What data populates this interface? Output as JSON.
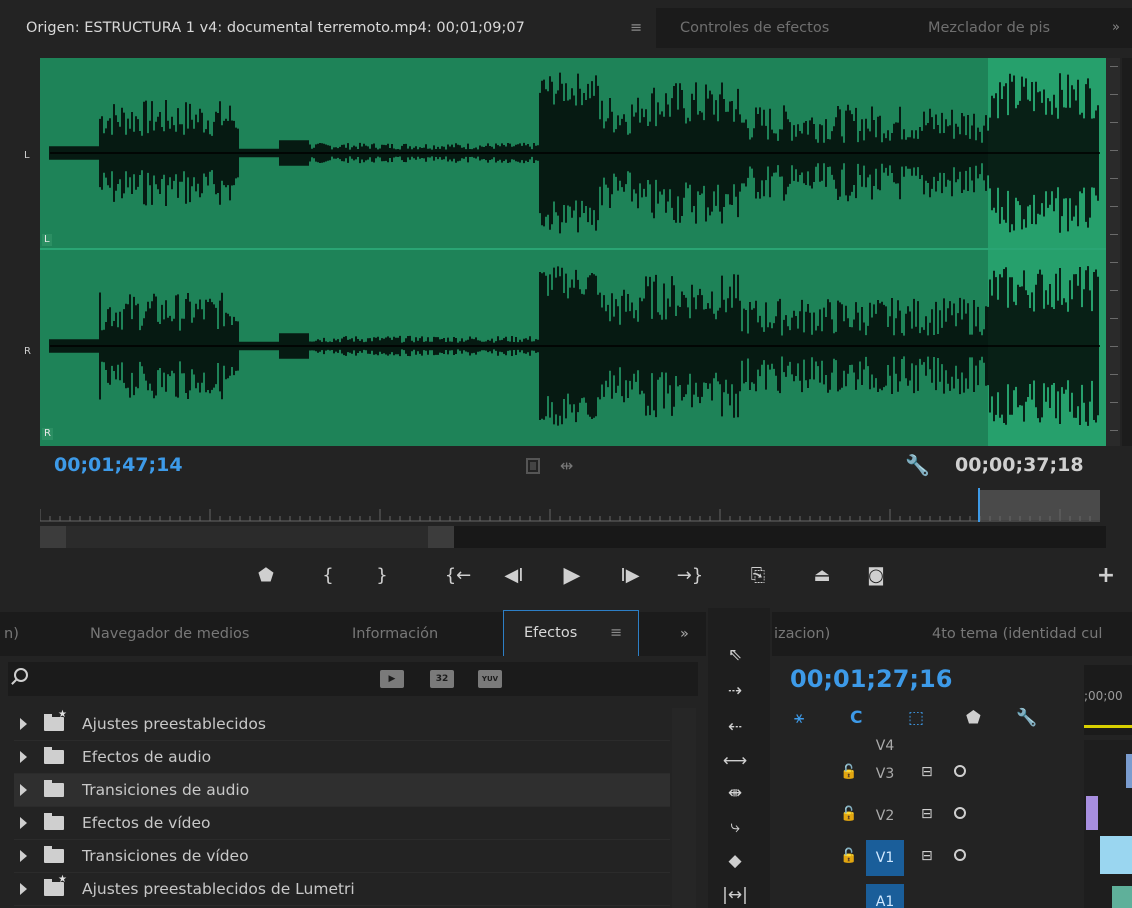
{
  "source_monitor": {
    "title": "Origen: ESTRUCTURA 1 v4: documental terremoto.mp4: 00;01;09;07",
    "menu_glyph": "≡",
    "tabs": [
      "Controles de efectos",
      "Mezclador de pis"
    ],
    "more_glyph": "»",
    "channel_left": "L",
    "channel_right": "R",
    "timecode_current": "00;01;47;14",
    "timecode_duration": "00;00;37;18",
    "audio_waveform_color": "#1e8358",
    "out_region_color": "#26a06c",
    "transport": [
      "marker-icon",
      "mark-in-icon",
      "mark-out-icon",
      "go-to-in-icon",
      "step-back-icon",
      "play-icon",
      "step-forward-icon",
      "go-to-out-icon",
      "insert-icon",
      "overwrite-icon",
      "export-frame-icon",
      "add-button-icon"
    ]
  },
  "effects_panel": {
    "tabs": [
      "n)",
      "Navegador de medios",
      "Información",
      "Efectos"
    ],
    "active_tab": "Efectos",
    "menu_glyph": "≡",
    "more_glyph": "»",
    "search_placeholder": "",
    "filter_badges": [
      "▶",
      "32",
      "YUV"
    ],
    "items": [
      {
        "label": "Ajustes preestablecidos",
        "star": true
      },
      {
        "label": "Efectos de audio",
        "star": false
      },
      {
        "label": "Transiciones de audio",
        "star": false,
        "highlighted": true
      },
      {
        "label": "Efectos de vídeo",
        "star": false
      },
      {
        "label": "Transiciones de vídeo",
        "star": false
      },
      {
        "label": "Ajustes preestablecidos de Lumetri",
        "star": true
      }
    ]
  },
  "timeline": {
    "tabs": [
      "izacion)",
      "4to tema (identidad cul"
    ],
    "timecode": "00;01;27;16",
    "ruler_label": ";00;00",
    "tracks": [
      {
        "name": "V4"
      },
      {
        "name": "V3"
      },
      {
        "name": "V2"
      },
      {
        "name": "V1",
        "targeted": true
      },
      {
        "name": "A1",
        "targeted": true
      }
    ],
    "accent": "#3d9ae8"
  }
}
